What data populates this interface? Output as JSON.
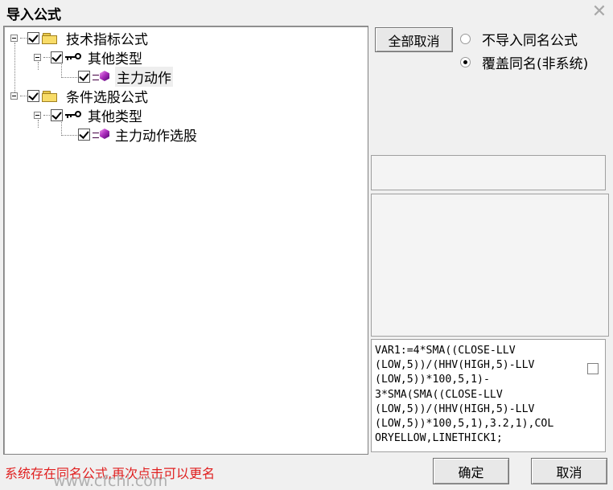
{
  "window": {
    "title": "导入公式",
    "close_label": "✕"
  },
  "tree": {
    "nodes": [
      {
        "label": "技术指标公式",
        "checked": true
      },
      {
        "label": "其他类型",
        "checked": true
      },
      {
        "label": "主力动作",
        "checked": true
      },
      {
        "label": "条件选股公式",
        "checked": true
      },
      {
        "label": "其他类型",
        "checked": true
      },
      {
        "label": "主力动作选股",
        "checked": true
      }
    ]
  },
  "buttons": {
    "cancel_all": "全部取消",
    "ok": "确定",
    "cancel": "取消"
  },
  "import_options": {
    "skip_same_name": "不导入同名公式",
    "overwrite_same_name": "覆盖同名(非系统)",
    "selected": "overwrite_same_name"
  },
  "formula": {
    "lines": [
      "VAR1:=4*SMA((CLOSE-LLV",
      "(LOW,5))/(HHV(HIGH,5)-LLV",
      "(LOW,5))*100,5,1)-",
      "3*SMA(SMA((CLOSE-LLV",
      "(LOW,5))/(HHV(HIGH,5)-LLV",
      "(LOW,5))*100,5,1),3.2,1),COL",
      "ORYELLOW,LINETHICK1;"
    ]
  },
  "status_message": "系统存在同名公式,再次点击可以更名",
  "watermark": "www.cfchi.com",
  "colors": {
    "status_text": "#e02020",
    "background": "#f0f0f0"
  }
}
